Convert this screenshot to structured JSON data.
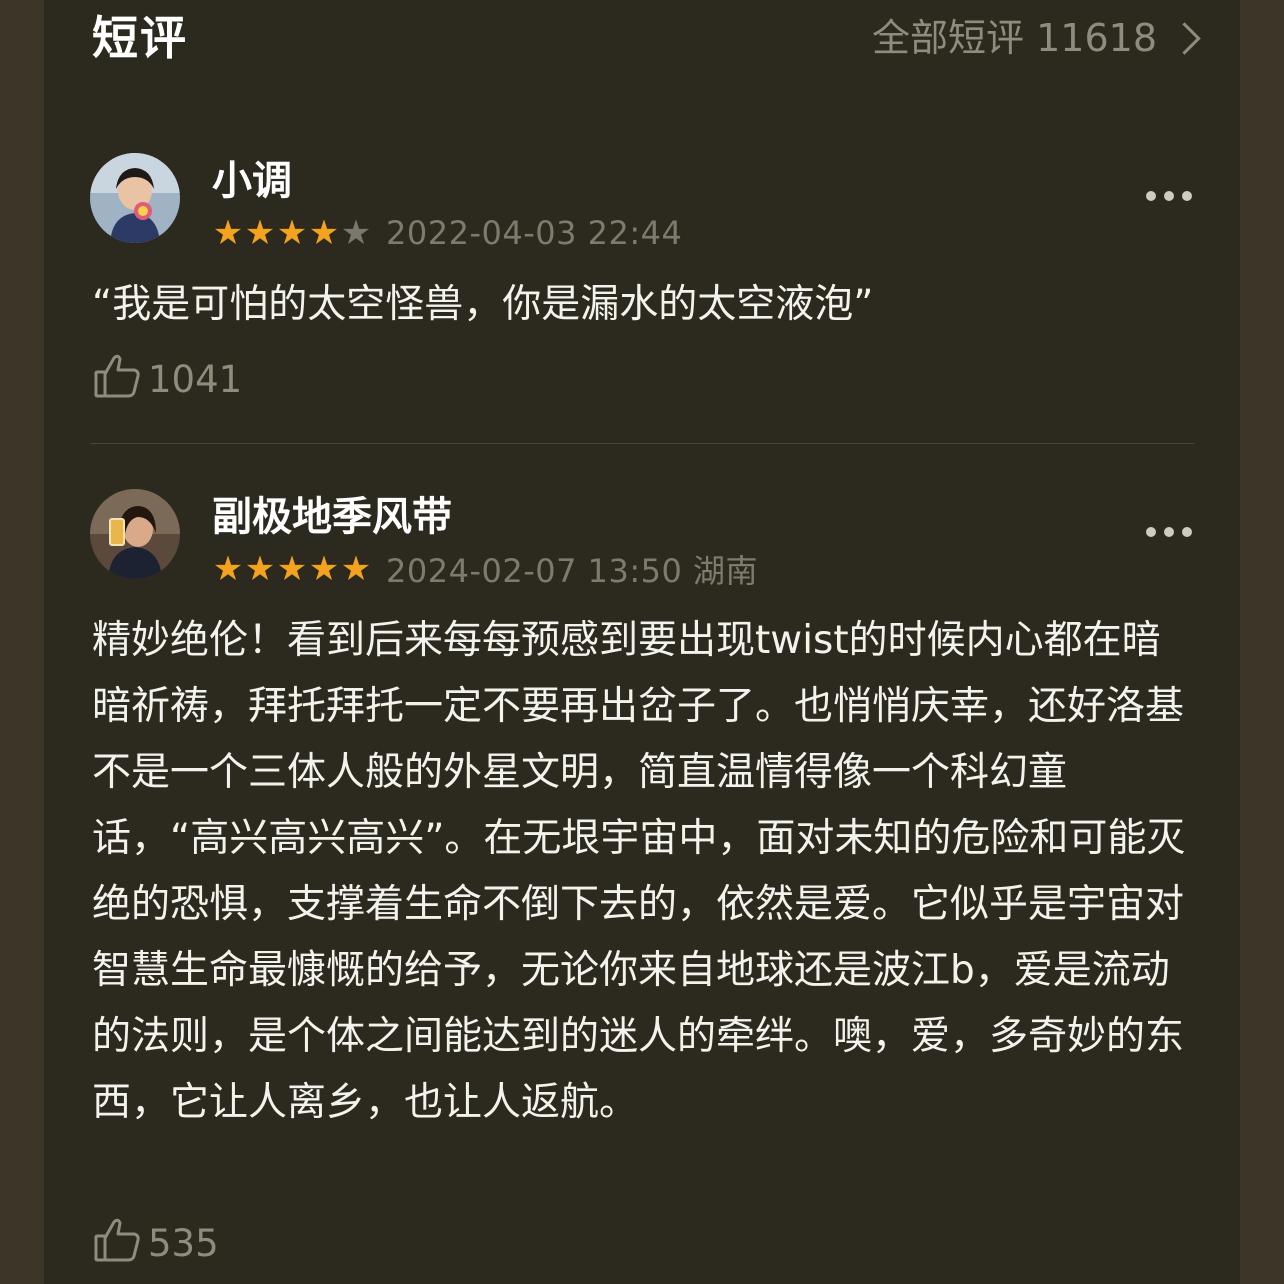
{
  "header": {
    "title": "短评",
    "all_label": "全部短评 11618"
  },
  "reviews": [
    {
      "user": "小调",
      "rating": 4,
      "max_rating": 5,
      "date": "2022-04-03 22:44",
      "text": "“我是可怕的太空怪兽，你是漏水的太空液泡”",
      "likes": "1041"
    },
    {
      "user": "副极地季风带",
      "rating": 5,
      "max_rating": 5,
      "date": "2024-02-07 13:50 湖南",
      "text": "精妙绝伦！看到后来每每预感到要出现twist的时候内心都在暗暗祈祷，拜托拜托一定不要再出岔子了。也悄悄庆幸，还好洛基不是一个三体人般的外星文明，简直温情得像一个科幻童话，“高兴高兴高兴”。在无垠宇宙中，面对未知的危险和可能灭绝的恐惧，支撑着生命不倒下去的，依然是爱。它似乎是宇宙对智慧生命最慷慨的给予，无论你来自地球还是波江b，爱是流动的法则，是个体之间能达到的迷人的牵绊。噢，爱，多奇妙的东西，它让人离乡，也让人返航。",
      "likes": "535"
    }
  ],
  "icons": {
    "more": "more-icon",
    "like": "thumb-up-icon",
    "chevron": "chevron-right-icon",
    "star": "star-icon"
  },
  "colors": {
    "star_on": "#f4a11c",
    "star_off": "#7a776c",
    "background": "#2c2a1f",
    "muted_text": "#8f8b7d"
  }
}
